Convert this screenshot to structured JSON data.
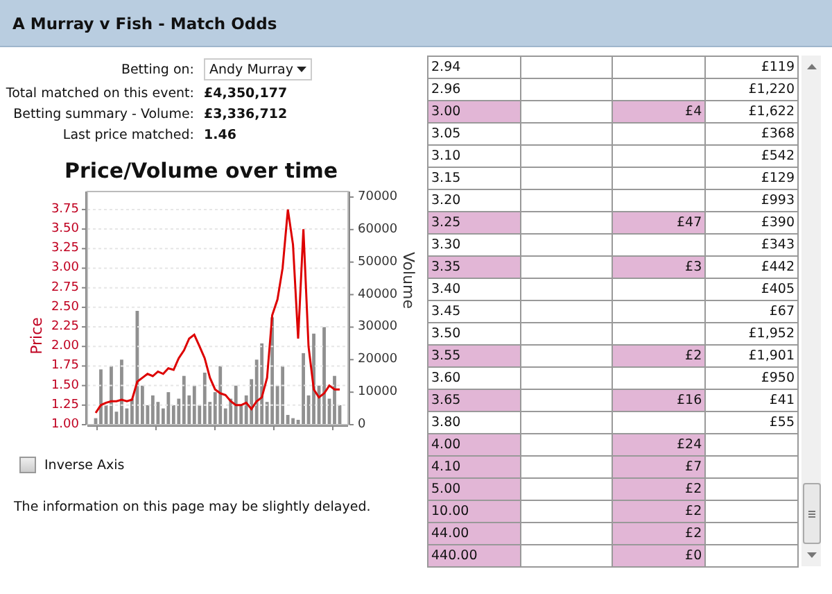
{
  "window": {
    "title": "A Murray v Fish - Match Odds"
  },
  "summary": {
    "betting_on_label": "Betting on:",
    "betting_on_value": "Andy Murray",
    "items": [
      {
        "label": "Total matched on this event:",
        "value": "£4,350,177"
      },
      {
        "label": "Betting summary - Volume:",
        "value": "£3,336,712"
      },
      {
        "label": "Last price matched:",
        "value": "1.46"
      }
    ]
  },
  "chart": {
    "chart_data": {
      "type": "line",
      "title": "Price/Volume over time",
      "ylabel": "Price",
      "grid": true,
      "ylim": [
        1,
        3.98
      ],
      "yticks": [
        {
          "value": 1,
          "label": "1.00"
        },
        {
          "value": 1.25,
          "label": "1.25"
        },
        {
          "value": 1.5,
          "label": "1.50"
        },
        {
          "value": 1.75,
          "label": "1.75"
        },
        {
          "value": 2,
          "label": "2.00"
        },
        {
          "value": 2.25,
          "label": "2.25"
        },
        {
          "value": 2.5,
          "label": "2.50"
        },
        {
          "value": 2.75,
          "label": "2.75"
        },
        {
          "value": 3,
          "label": "3.00"
        },
        {
          "value": 3.25,
          "label": "3.25"
        },
        {
          "value": 3.5,
          "label": "3.50"
        },
        {
          "value": 3.75,
          "label": "3.75"
        }
      ],
      "series": [
        {
          "color": "#dd0000",
          "values": [
            1.15,
            1.25,
            1.28,
            1.3,
            1.3,
            1.32,
            1.3,
            1.32,
            1.55,
            1.6,
            1.65,
            1.62,
            1.68,
            1.65,
            1.72,
            1.7,
            1.85,
            1.95,
            2.1,
            2.15,
            2.0,
            1.85,
            1.6,
            1.45,
            1.4,
            1.38,
            1.3,
            1.25,
            1.25,
            1.28,
            1.2,
            1.3,
            1.35,
            1.6,
            2.4,
            2.6,
            3.0,
            3.75,
            3.3,
            2.1,
            3.5,
            2.0,
            1.45,
            1.35,
            1.4,
            1.5,
            1.45,
            1.45
          ]
        }
      ]
    }
  },
  "volume_axis": {
    "label": "Volume",
    "ticks": [
      "70000",
      "60000",
      "50000",
      "40000",
      "30000",
      "20000",
      "10000",
      "0"
    ]
  },
  "inverse_axis": {
    "label": "Inverse Axis",
    "checked": false
  },
  "notice": "The information on this page may be slightly delayed.",
  "table": {
    "rows": [
      {
        "column_1": "2.94",
        "column_4": "£119",
        "highlighted": false
      },
      {
        "column_1": "2.96",
        "column_4": "£1,220",
        "highlighted": false
      },
      {
        "column_1": "3.00",
        "column_3": "£4",
        "column_4": "£1,622",
        "highlighted": true
      },
      {
        "column_1": "3.05",
        "column_4": "£368",
        "highlighted": false
      },
      {
        "column_1": "3.10",
        "column_4": "£542",
        "highlighted": false
      },
      {
        "column_1": "3.15",
        "column_4": "£129",
        "highlighted": false
      },
      {
        "column_1": "3.20",
        "column_4": "£993",
        "highlighted": false
      },
      {
        "column_1": "3.25",
        "column_3": "£47",
        "column_4": "£390",
        "highlighted": true
      },
      {
        "column_1": "3.30",
        "column_4": "£343",
        "highlighted": false
      },
      {
        "column_1": "3.35",
        "column_3": "£3",
        "column_4": "£442",
        "highlighted": true
      },
      {
        "column_1": "3.40",
        "column_4": "£405",
        "highlighted": false
      },
      {
        "column_1": "3.45",
        "column_4": "£67",
        "highlighted": false
      },
      {
        "column_1": "3.50",
        "column_4": "£1,952",
        "highlighted": false
      },
      {
        "column_1": "3.55",
        "column_3": "£2",
        "column_4": "£1,901",
        "highlighted": true
      },
      {
        "column_1": "3.60",
        "column_4": "£950",
        "highlighted": false
      },
      {
        "column_1": "3.65",
        "column_3": "£16",
        "column_4": "£41",
        "highlighted": true
      },
      {
        "column_1": "3.80",
        "column_4": "£55",
        "highlighted": false
      },
      {
        "column_1": "4.00",
        "column_3": "£24",
        "highlighted": true
      },
      {
        "column_1": "4.10",
        "column_3": "£7",
        "highlighted": true
      },
      {
        "column_1": "5.00",
        "column_3": "£2",
        "highlighted": true
      },
      {
        "column_1": "10.00",
        "column_3": "£2",
        "highlighted": true
      },
      {
        "column_1": "44.00",
        "column_3": "£2",
        "highlighted": true
      },
      {
        "column_1": "440.00",
        "column_3": "£0",
        "highlighted": true
      }
    ]
  }
}
